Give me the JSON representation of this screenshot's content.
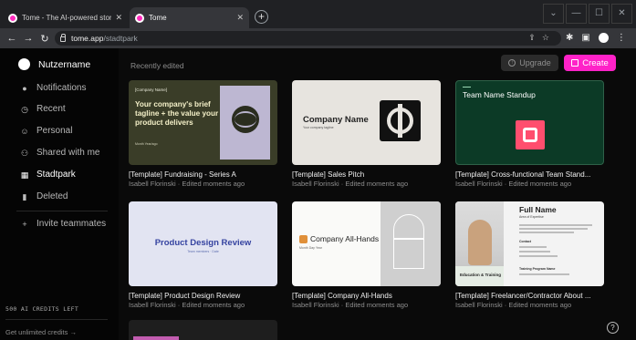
{
  "browser": {
    "tabs": [
      {
        "title": "Tome - The AI-powered storytelli",
        "active": false
      },
      {
        "title": "Tome",
        "active": true
      }
    ],
    "new_tab_label": "+",
    "url_host": "tome.app",
    "url_path": "/stadtpark",
    "window_controls": [
      "⌄",
      "—",
      "☐",
      "✕"
    ]
  },
  "sidebar": {
    "user_name": "Nutzername",
    "items": [
      {
        "label": "Notifications",
        "icon": "bell-icon",
        "glyph": "●"
      },
      {
        "label": "Recent",
        "icon": "clock-icon",
        "glyph": "◷"
      },
      {
        "label": "Personal",
        "icon": "person-icon",
        "glyph": "☺"
      },
      {
        "label": "Shared with me",
        "icon": "people-icon",
        "glyph": "⚇"
      },
      {
        "label": "Stadtpark",
        "icon": "building-icon",
        "glyph": "▦",
        "selected": true
      },
      {
        "label": "Deleted",
        "icon": "trash-icon",
        "glyph": "▮"
      }
    ],
    "invite_label": "Invite teammates",
    "credits_text": "500 AI CREDITS LEFT",
    "unlimited_text": "Get unlimited credits →"
  },
  "main": {
    "section_label": "Recently edited",
    "upgrade_label": "Upgrade",
    "create_label": "Create",
    "cards": [
      {
        "title": "[Template] Fundraising - Series A",
        "meta": "Isabell Florinski · Edited moments ago"
      },
      {
        "title": "[Template] Sales Pitch",
        "meta": "Isabell Florinski · Edited moments ago"
      },
      {
        "title": "[Template] Cross-functional Team Stand...",
        "meta": "Isabell Florinski · Edited moments ago"
      },
      {
        "title": "[Template] Product Design Review",
        "meta": "Isabell Florinski · Edited moments ago"
      },
      {
        "title": "[Template] Company All-Hands",
        "meta": "Isabell Florinski · Edited moments ago"
      },
      {
        "title": "[Template] Freelancer/Contractor About ...",
        "meta": "Isabell Florinski · Edited moments ago"
      }
    ]
  },
  "thumbs": {
    "t1": {
      "small": "[Company Name]",
      "big": "Your company's brief tagline + the value your product delivers",
      "tiny": "Month Year/ago"
    },
    "t2": {
      "name": "Company Name",
      "tag": "Your company tagline"
    },
    "t3": {
      "head": "Team Name Standup"
    },
    "t4": {
      "title": "Product Design Review",
      "sub": "Team members · Date"
    },
    "t5": {
      "name": "Company All-Hands",
      "tiny": "Month Day Year"
    },
    "t6": {
      "fullname": "Full Name",
      "area": "Area of Expertise",
      "education": "Education & Training",
      "contact": "Contact",
      "training": "Training Program Name"
    }
  },
  "help_label": "?"
}
